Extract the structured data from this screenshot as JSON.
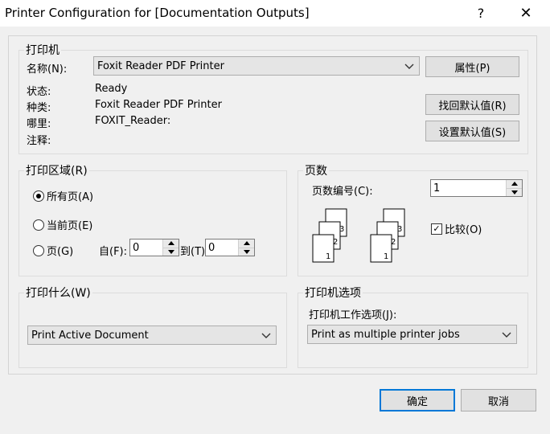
{
  "window": {
    "title": "Printer Configuration for [Documentation Outputs]",
    "help_glyph": "?",
    "close_glyph": "✕"
  },
  "printer": {
    "group_label": "打印机",
    "name_label": "名称",
    "name_hotkey": "(N):",
    "name_value": "Foxit Reader PDF Printer",
    "status_label": "状态:",
    "status_value": "Ready",
    "type_label": "种类:",
    "type_value": "Foxit Reader PDF Printer",
    "where_label": "哪里:",
    "where_value": "FOXIT_Reader:",
    "comment_label": "注释:",
    "properties_button": "属性(P)",
    "restore_defaults_button": "找回默认值(R)",
    "set_defaults_button": "设置默认值(S)"
  },
  "print_range": {
    "group_label": "打印区域(R)",
    "all_pages": "所有页(A)",
    "current_page": "当前页(E)",
    "pages": "页(G)",
    "from_label": "自(F):",
    "from_value": "0",
    "to_label": "到(T):",
    "to_value": "0",
    "selected": "all_pages"
  },
  "copies": {
    "group_label": "页数",
    "number_label": "页数编号(C):",
    "number_value": "1",
    "collate_label": "比较(O)",
    "collate_checked": true,
    "check_glyph": "✓"
  },
  "print_what": {
    "group_label": "打印什么(W)",
    "value": "Print Active Document"
  },
  "printer_options": {
    "group_label": "打印机选项",
    "job_label": "打印机工作选项(J):",
    "job_value": "Print as multiple printer jobs"
  },
  "footer": {
    "ok_button": "确定",
    "cancel_button": "取消"
  }
}
